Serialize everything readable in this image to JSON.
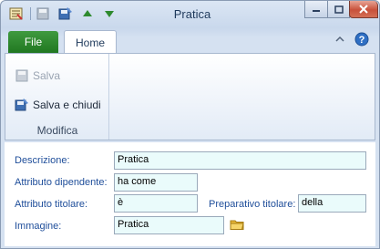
{
  "window": {
    "title": "Pratica"
  },
  "quick_access": {
    "icons": [
      "app-icon",
      "save-icon",
      "save-close-icon",
      "up-arrow-icon",
      "down-arrow-icon"
    ]
  },
  "ribbon": {
    "tabs": [
      {
        "label": "File"
      },
      {
        "label": "Home"
      }
    ],
    "groups": [
      {
        "label": "Modifica",
        "buttons": [
          {
            "label": "Salva",
            "enabled": false
          },
          {
            "label": "Salva e chiudi",
            "enabled": true
          }
        ]
      }
    ]
  },
  "form": {
    "descrizione": {
      "label": "Descrizione:",
      "value": "Pratica"
    },
    "attributo_dipendente": {
      "label": "Attributo dipendente:",
      "value": "ha come"
    },
    "attributo_titolare": {
      "label": "Attributo titolare:",
      "value": "è"
    },
    "preparativo_titolare": {
      "label": "Preparativo titolare:",
      "value": "della"
    },
    "immagine": {
      "label": "Immagine:",
      "value": "Pratica"
    }
  },
  "colors": {
    "file_tab": "#2a8a2a",
    "label_text": "#1f4e9a",
    "field_background": "#eafbfb",
    "close_button": "#c8513a"
  }
}
